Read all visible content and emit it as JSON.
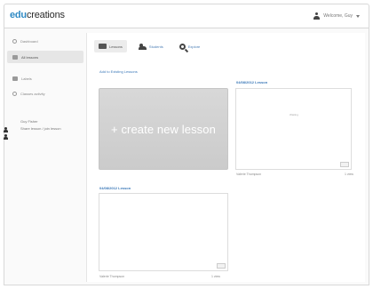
{
  "app": {
    "logo_edu": "edu",
    "logo_rest": "creations"
  },
  "header": {
    "user_name": "Welcome, Guy"
  },
  "sidebar": {
    "items": [
      {
        "label": "Dashboard",
        "icon": "gear-icon"
      },
      {
        "label": "All lessons",
        "icon": "folder-icon"
      },
      {
        "label": "Labels",
        "icon": "label-icon"
      },
      {
        "label": "Classes activity",
        "icon": "classes-icon"
      }
    ],
    "people": [
      {
        "label": "Guy Fisher"
      },
      {
        "label": "Share lesson / join lesson"
      }
    ]
  },
  "tabs": [
    {
      "label": "Lessons",
      "icon": "lessons-icon"
    },
    {
      "label": "Students",
      "icon": "people-icon"
    },
    {
      "label": "Explore",
      "icon": "search-icon"
    }
  ],
  "main": {
    "add_link": "Add to Existing Lessons",
    "create_label": "+ create new lesson",
    "lessons": [
      {
        "title": "04/08/2012 Lesson",
        "status": "Waiting",
        "author": "Valerie Thompson",
        "views": "1 view"
      },
      {
        "title": "04/08/2012 Lesson",
        "status": "",
        "author": "Valerie Thompson",
        "views": "1 view"
      }
    ]
  }
}
